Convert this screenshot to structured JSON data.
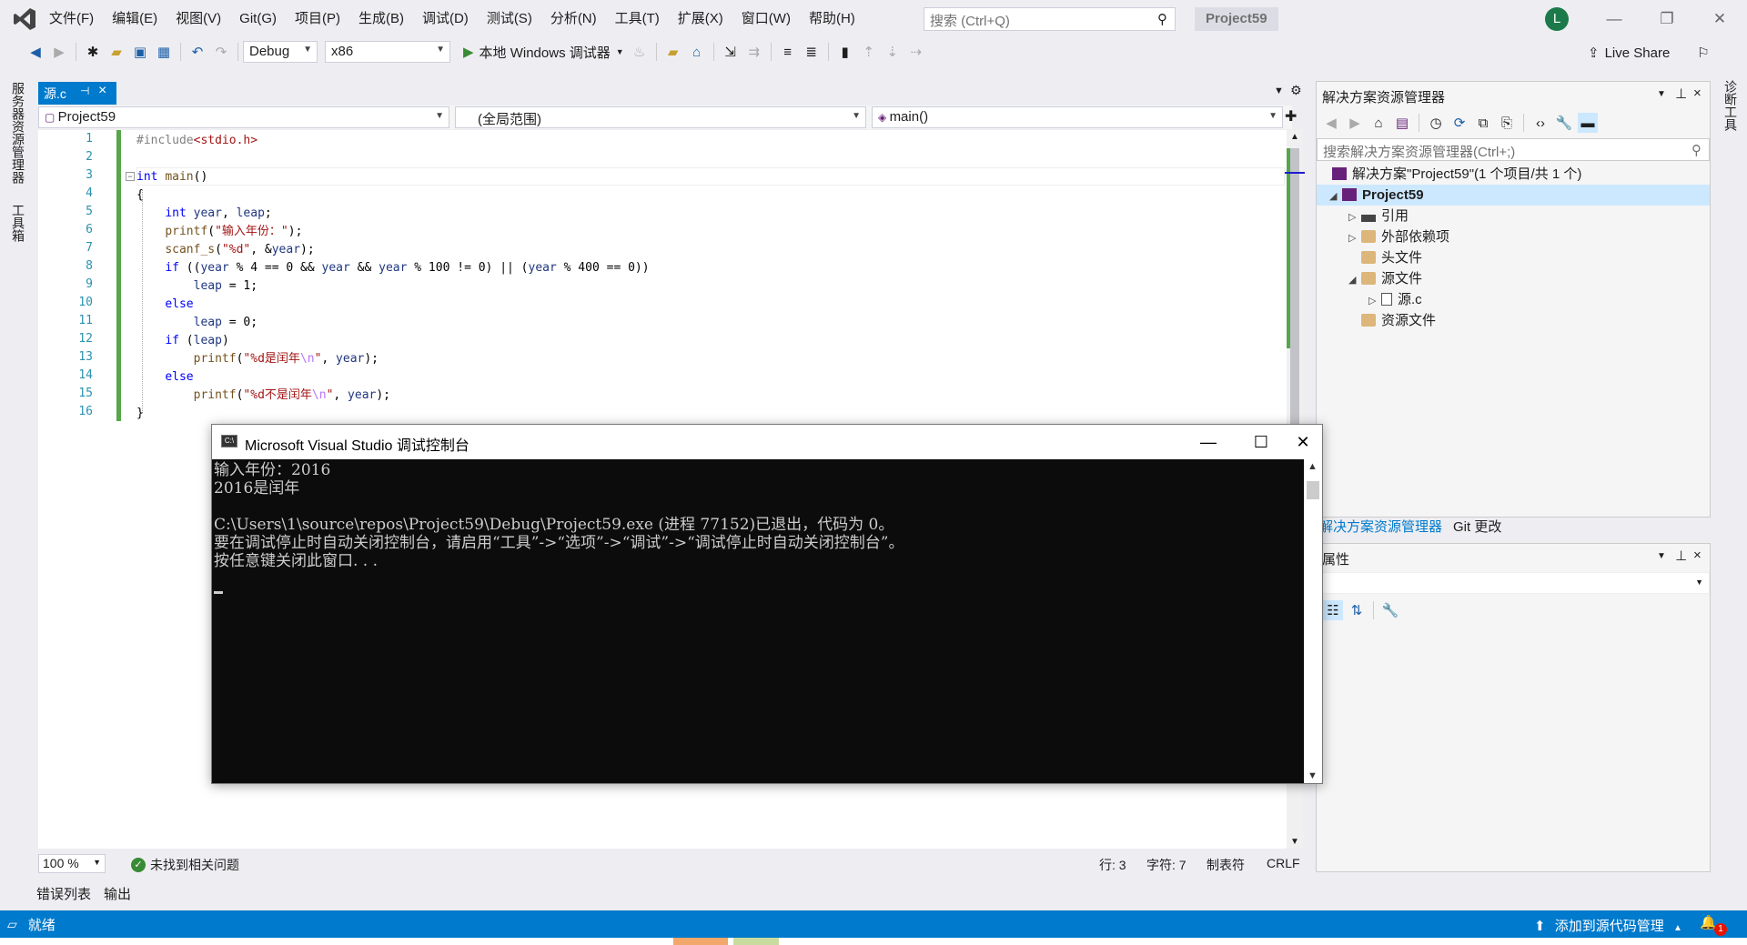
{
  "menu": {
    "items": [
      "文件(F)",
      "编辑(E)",
      "视图(V)",
      "Git(G)",
      "项目(P)",
      "生成(B)",
      "调试(D)",
      "测试(S)",
      "分析(N)",
      "工具(T)",
      "扩展(X)",
      "窗口(W)",
      "帮助(H)"
    ],
    "search_placeholder": "搜索 (Ctrl+Q)",
    "project_badge": "Project59",
    "avatar_letter": "L"
  },
  "toolbar": {
    "config": "Debug",
    "platform": "x86",
    "run_label": "本地 Windows 调试器",
    "live_share": "Live Share"
  },
  "left_strip": {
    "tab1": "服务器资源管理器",
    "tab2": "工具箱"
  },
  "right_strip": {
    "tab1": "诊断工具"
  },
  "editor": {
    "tab_name": "源.c",
    "nav_project": "Project59",
    "nav_scope": "(全局范围)",
    "nav_function": "main()",
    "line_numbers": [
      "1",
      "2",
      "3",
      "4",
      "5",
      "6",
      "7",
      "8",
      "9",
      "10",
      "11",
      "12",
      "13",
      "14",
      "15",
      "16"
    ],
    "zoom": "100 %",
    "issues": "未找到相关问题",
    "row": "行: 3",
    "col": "字符: 7",
    "tabs_mode": "制表符",
    "eol": "CRLF"
  },
  "bottom_tabs": [
    "错误列表",
    "输出"
  ],
  "statusbar": {
    "ready": "就绪",
    "source_control": "添加到源代码管理",
    "notif_count": "1"
  },
  "solution_explorer": {
    "title": "解决方案资源管理器",
    "search_placeholder": "搜索解决方案资源管理器(Ctrl+;)",
    "solution": "解决方案\"Project59\"(1 个项目/共 1 个)",
    "project": "Project59",
    "nodes": [
      "引用",
      "外部依赖项",
      "头文件",
      "源文件",
      "源.c",
      "资源文件"
    ],
    "tab_active": "解决方案资源管理器",
    "tab_other": "Git 更改"
  },
  "properties": {
    "title": "属性"
  },
  "console": {
    "title": "Microsoft Visual Studio 调试控制台",
    "icon_text": "C:\\",
    "lines": [
      "输入年份：2016",
      "2016是闰年",
      "",
      "C:\\Users\\1\\source\\repos\\Project59\\Debug\\Project59.exe (进程 77152)已退出，代码为 0。",
      "要在调试停止时自动关闭控制台，请启用“工具”->“选项”->“调试”->“调试停止时自动关闭控制台”。",
      "按任意键关闭此窗口. . ."
    ]
  },
  "colors": {
    "accent": "#007acc",
    "keyword": "#0000ff",
    "string": "#a31515",
    "console_bg": "#0c0c0c",
    "change_bar": "#57a64a"
  }
}
